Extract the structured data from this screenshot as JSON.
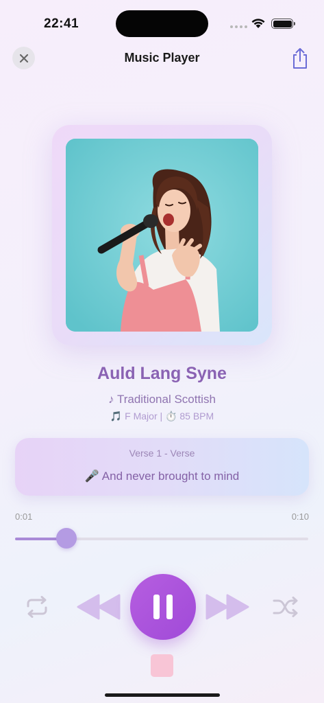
{
  "status_bar": {
    "time": "22:41"
  },
  "nav": {
    "title": "Music Player"
  },
  "track": {
    "title": "Auld Lang Syne",
    "artist": "♪ Traditional Scottish",
    "meta": "🎵 F Major | ⏱️ 85 BPM"
  },
  "lyrics": {
    "verse_label": "Verse 1 - Verse",
    "line": "🎤 And never brought to mind"
  },
  "progress": {
    "current": "0:01",
    "total": "0:10",
    "fraction": 0.175
  },
  "controls": {
    "icons": [
      "repeat-icon",
      "rewind-icon",
      "pause-icon",
      "fast-forward-icon",
      "shuffle-icon",
      "stop-icon"
    ]
  },
  "colors": {
    "accent": "#a98ad7",
    "play_button": "#ac55dc",
    "title": "#8a62b3",
    "stop_button": "#f8c5d6"
  }
}
